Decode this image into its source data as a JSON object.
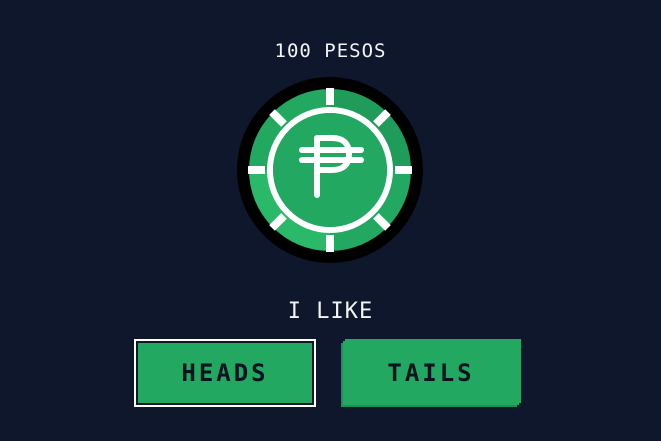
{
  "bet": {
    "label": "100 PESOS"
  },
  "coin": {
    "symbol": "peso-sign-icon",
    "face_color": "#22a860",
    "rim_color": "#000000"
  },
  "prompt": {
    "text": "I LIKE"
  },
  "choices": {
    "heads_label": "HEADS",
    "tails_label": "TAILS",
    "selected": "HEADS"
  },
  "colors": {
    "background": "#0e172b",
    "button": "#22a860",
    "text": "#f2f4f7"
  }
}
